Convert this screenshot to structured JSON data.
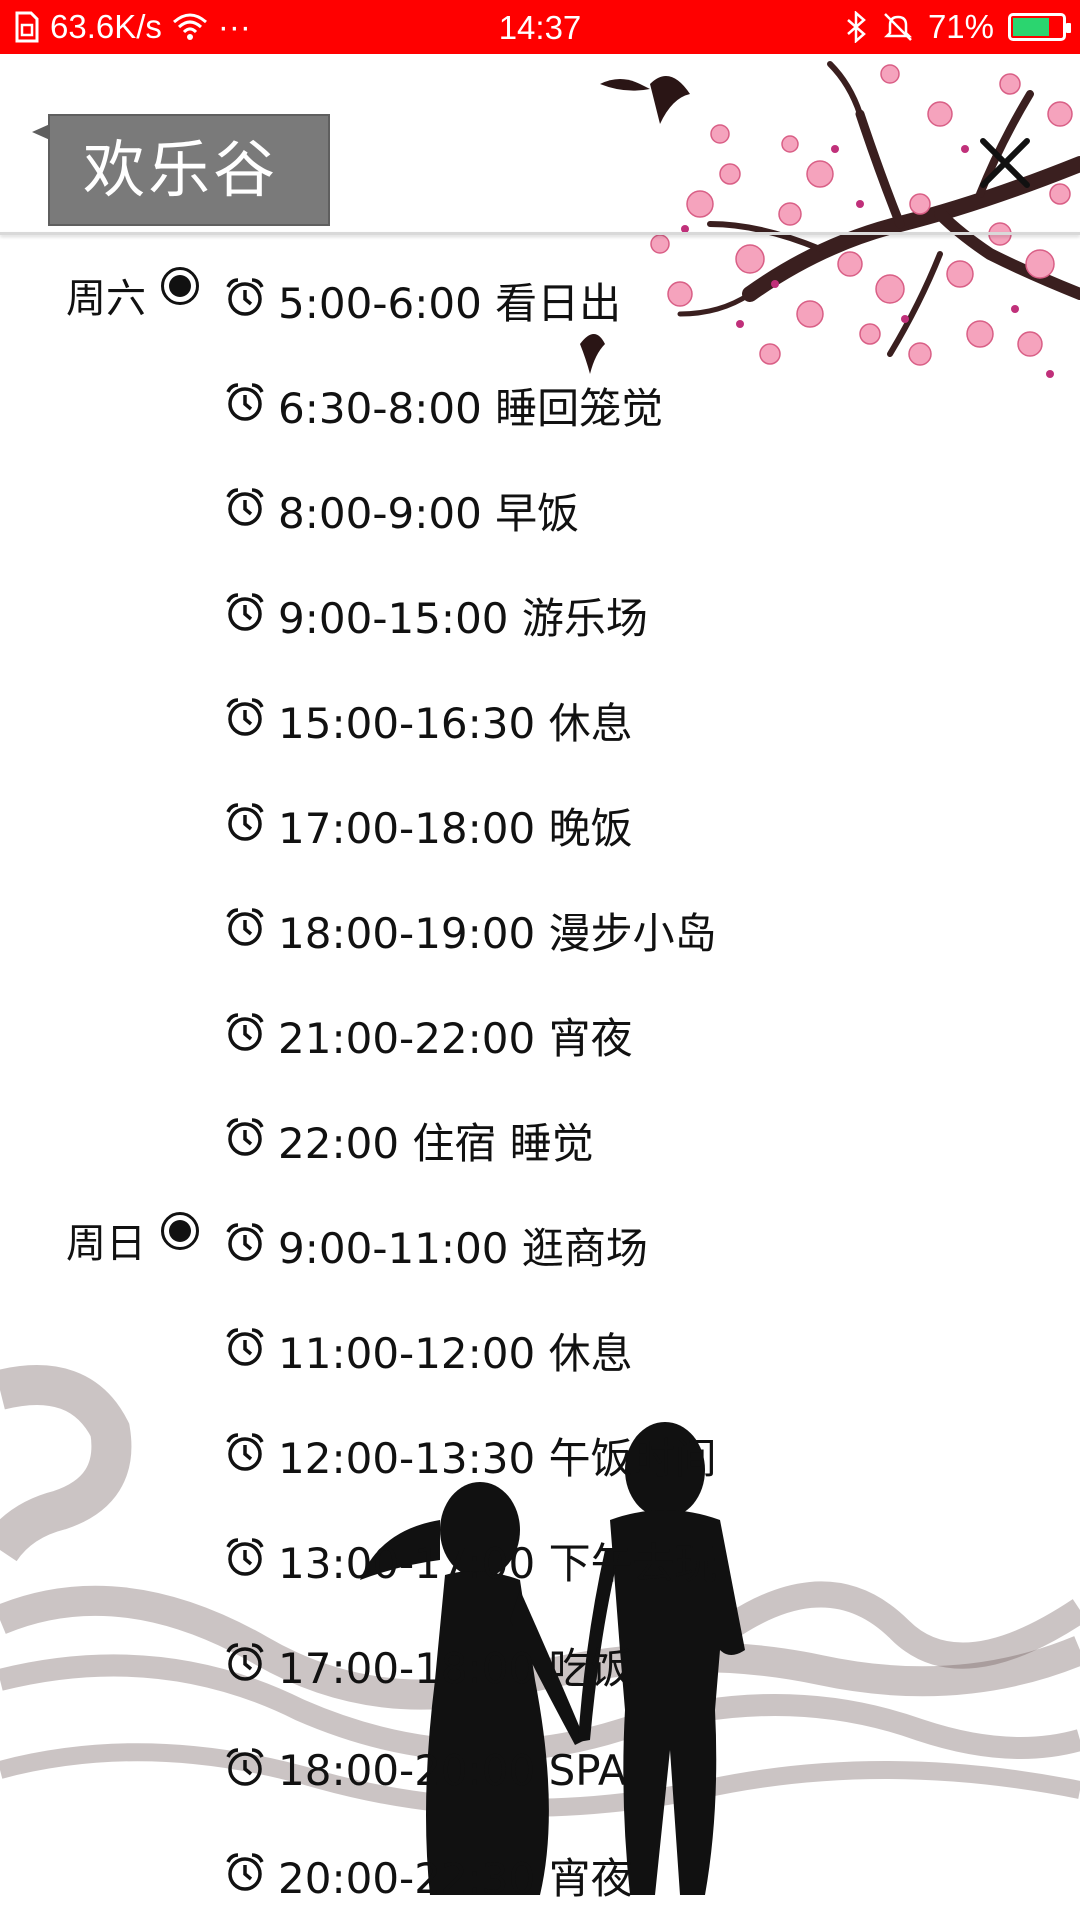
{
  "status_bar": {
    "speed": "63.6K/s",
    "more": "···",
    "time": "14:37",
    "battery": "71%",
    "icons": [
      "sim-icon",
      "wifi-icon",
      "bluetooth-icon",
      "mute-icon",
      "battery-icon"
    ],
    "background": "#ff0000"
  },
  "header": {
    "title": "欢乐谷",
    "close_icon": "close-icon"
  },
  "schedule": [
    {
      "day": "周六",
      "items": [
        "5:00-6:00 看日出",
        "6:30-8:00 睡回笼觉",
        "8:00-9:00 早饭",
        "9:00-15:00 游乐场",
        "15:00-16:30 休息",
        "17:00-18:00 晚饭",
        "18:00-19:00 漫步小岛",
        "21:00-22:00 宵夜",
        "22:00 住宿 睡觉"
      ]
    },
    {
      "day": "周日",
      "items": [
        "9:00-11:00 逛商场",
        "11:00-12:00 休息",
        "12:00-13:30 午饭时间",
        "13:00-17:00 下午去玩",
        "17:00-18:00 吃饭",
        "18:00-20:00 SPA",
        "20:00-22:30 宵夜"
      ]
    }
  ]
}
